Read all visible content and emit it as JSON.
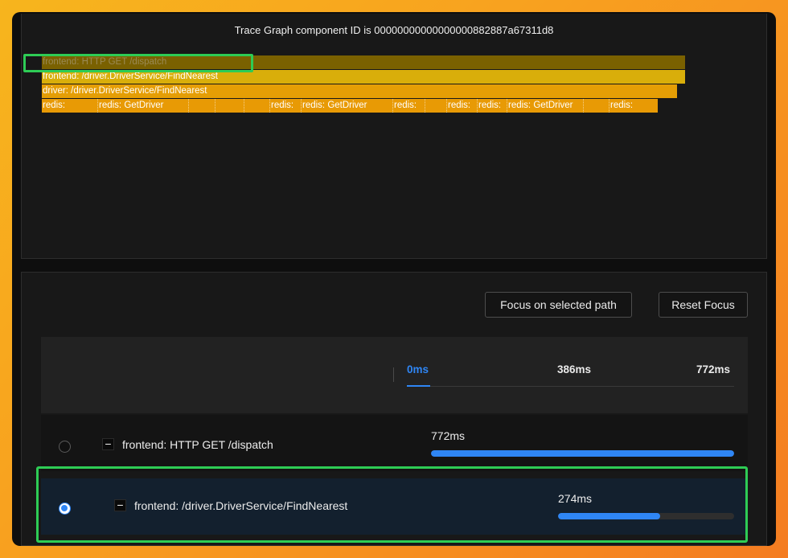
{
  "flame": {
    "title": "Trace Graph component ID is 00000000000000000882887a67311d8",
    "rows": [
      "frontend: HTTP GET /dispatch",
      "frontend: /driver.DriverService/FindNearest",
      "driver: /driver.DriverService/FindNearest"
    ],
    "redis_segments": [
      "redis:",
      "redis: GetDriver",
      "",
      "",
      "",
      "redis:",
      "redis: GetDriver",
      "redis:",
      "",
      "redis:",
      "redis:",
      "redis: GetDriver",
      "",
      "redis:"
    ]
  },
  "toolbar": {
    "focus_label": "Focus on selected path",
    "reset_label": "Reset Focus"
  },
  "timeline": {
    "ticks": [
      "0ms",
      "386ms",
      "772ms"
    ]
  },
  "rows": [
    {
      "label": "frontend: HTTP GET /dispatch",
      "duration": "772ms",
      "progress": 1.0,
      "selected": false,
      "collapse_symbol": "−"
    },
    {
      "label": "frontend: /driver.DriverService/FindNearest",
      "duration": "274ms",
      "progress": 0.58,
      "selected": true,
      "collapse_symbol": "−"
    }
  ],
  "colors": {
    "accent": "#2f86f5",
    "highlight": "#2ecc55",
    "flame_root": "#7a6100",
    "flame_selected": "#d9ae0a",
    "flame_child": "#e59e05"
  }
}
